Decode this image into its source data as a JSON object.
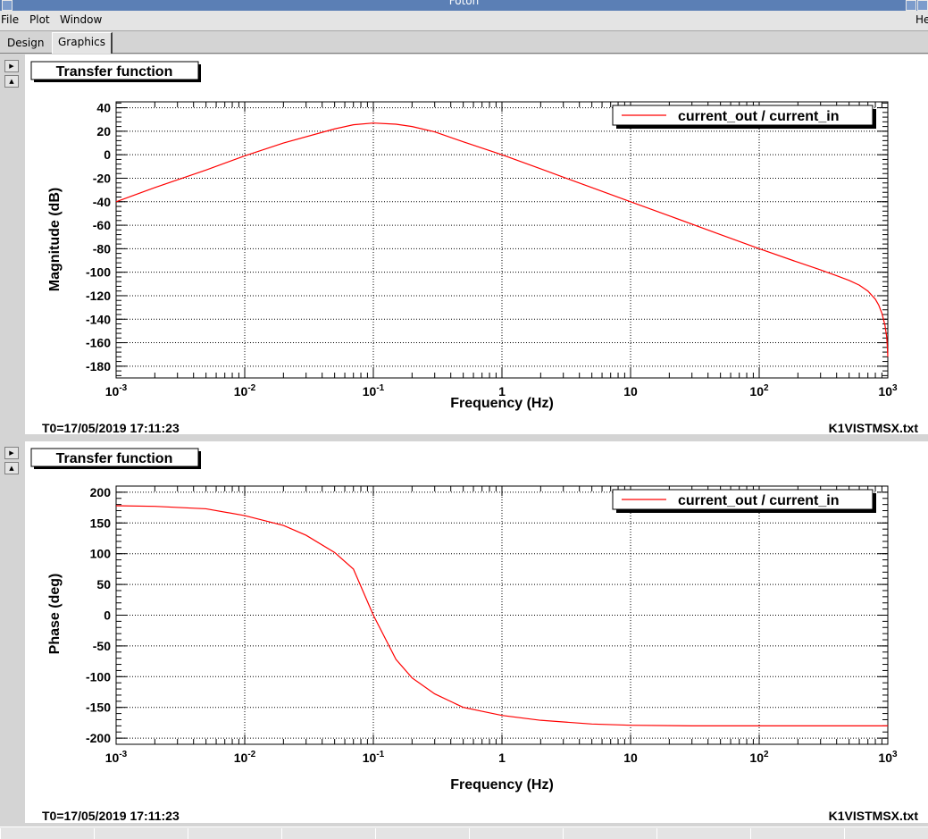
{
  "window": {
    "title": "Foton"
  },
  "menu": {
    "file": "File",
    "plot": "Plot",
    "window": "Window",
    "help": "He"
  },
  "tabs": {
    "design": "Design",
    "graphics": "Graphics"
  },
  "colors": {
    "trace": "#ff0000",
    "grid": "#000000",
    "background": "#ffffff"
  },
  "chart_data": [
    {
      "type": "line",
      "title": "Transfer function",
      "xlabel": "Frequency (Hz)",
      "ylabel": "Magnitude (dB)",
      "xscale": "log",
      "xlim": [
        0.001,
        1000
      ],
      "ylim": [
        -190,
        45
      ],
      "x_ticks": [
        0.001,
        0.01,
        0.1,
        1,
        10,
        100,
        1000
      ],
      "x_tick_labels": [
        {
          "base": "10",
          "exp": "-3"
        },
        {
          "base": "10",
          "exp": "-2"
        },
        {
          "base": "10",
          "exp": "-1"
        },
        {
          "base": "1",
          "exp": ""
        },
        {
          "base": "10",
          "exp": ""
        },
        {
          "base": "10",
          "exp": "2"
        },
        {
          "base": "10",
          "exp": "3"
        }
      ],
      "y_ticks": [
        40,
        20,
        0,
        -20,
        -40,
        -60,
        -80,
        -100,
        -120,
        -140,
        -160,
        -180
      ],
      "grid": true,
      "legend": "top-right",
      "series": [
        {
          "name": "current_out / current_in",
          "x": [
            0.001,
            0.002,
            0.005,
            0.01,
            0.02,
            0.05,
            0.07,
            0.1,
            0.15,
            0.2,
            0.3,
            0.5,
            1,
            2,
            5,
            10,
            20,
            50,
            100,
            200,
            300,
            400,
            500,
            600,
            700,
            800,
            850,
            900,
            950,
            980,
            990,
            1000
          ],
          "y": [
            -40,
            -28,
            -13,
            -1,
            10,
            22,
            25.5,
            27,
            26,
            24,
            19.5,
            11,
            0,
            -12,
            -28,
            -40,
            -52,
            -68,
            -80,
            -91.5,
            -98,
            -103,
            -107,
            -111,
            -116,
            -123,
            -128,
            -135,
            -145,
            -155,
            -162,
            -172
          ]
        }
      ],
      "footer_left": "T0=17/05/2019 17:11:23",
      "footer_right": "K1VISTMSX.txt"
    },
    {
      "type": "line",
      "title": "Transfer function",
      "xlabel": "Frequency (Hz)",
      "ylabel": "Phase (deg)",
      "xscale": "log",
      "xlim": [
        0.001,
        1000
      ],
      "ylim": [
        -210,
        210
      ],
      "x_ticks": [
        0.001,
        0.01,
        0.1,
        1,
        10,
        100,
        1000
      ],
      "x_tick_labels": [
        {
          "base": "10",
          "exp": "-3"
        },
        {
          "base": "10",
          "exp": "-2"
        },
        {
          "base": "10",
          "exp": "-1"
        },
        {
          "base": "1",
          "exp": ""
        },
        {
          "base": "10",
          "exp": ""
        },
        {
          "base": "10",
          "exp": "2"
        },
        {
          "base": "10",
          "exp": "3"
        }
      ],
      "y_ticks": [
        200,
        150,
        100,
        50,
        0,
        -50,
        -100,
        -150,
        -200
      ],
      "grid": true,
      "legend": "top-right",
      "series": [
        {
          "name": "current_out / current_in",
          "x": [
            0.001,
            0.002,
            0.005,
            0.01,
            0.02,
            0.03,
            0.05,
            0.07,
            0.1,
            0.15,
            0.2,
            0.3,
            0.5,
            1,
            2,
            5,
            10,
            30,
            100,
            1000
          ],
          "y": [
            178,
            177,
            173,
            162,
            146,
            130,
            102,
            75,
            0,
            -72,
            -102,
            -128,
            -150,
            -163,
            -171,
            -177,
            -179,
            -180,
            -180,
            -180
          ]
        }
      ],
      "footer_left": "T0=17/05/2019 17:11:23",
      "footer_right": "K1VISTMSX.txt"
    }
  ]
}
